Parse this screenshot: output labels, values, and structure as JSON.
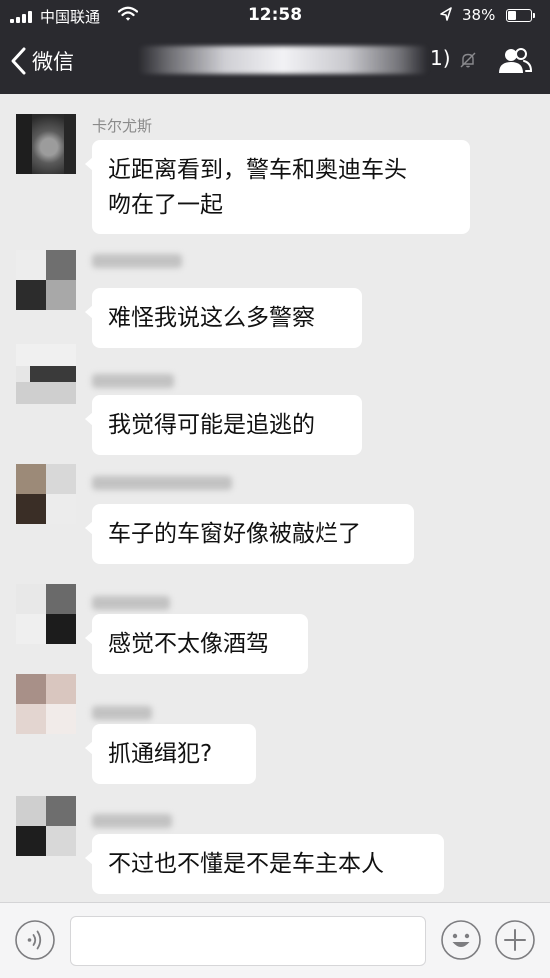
{
  "status_bar": {
    "carrier": "中国联通",
    "time": "12:58",
    "battery": "38%",
    "battery_level": 0.38
  },
  "nav": {
    "back_label": "微信",
    "title_count_fragment": "1)"
  },
  "messages": [
    {
      "sender": "卡尔尤斯",
      "text_lines": [
        "近距离看到，警车和奥迪车头",
        "吻在了一起"
      ]
    },
    {
      "sender": "",
      "text_lines": [
        "难怪我说这么多警察"
      ]
    },
    {
      "sender": "",
      "text_lines": [
        "我觉得可能是追逃的"
      ]
    },
    {
      "sender": "",
      "text_lines": [
        "车子的车窗好像被敲烂了"
      ]
    },
    {
      "sender": "",
      "text_lines": [
        "感觉不太像酒驾"
      ]
    },
    {
      "sender": "",
      "text_lines": [
        "抓通缉犯?"
      ]
    },
    {
      "sender": "",
      "text_lines": [
        "不过也不懂是不是车主本人"
      ]
    }
  ],
  "input_bar": {
    "voice_icon": "voice-icon",
    "emoji_icon": "emoji-icon",
    "plus_icon": "plus-icon"
  },
  "colors": {
    "nav_background": "#2a2a2f",
    "chat_background": "#ebebeb",
    "bubble": "#ffffff"
  }
}
